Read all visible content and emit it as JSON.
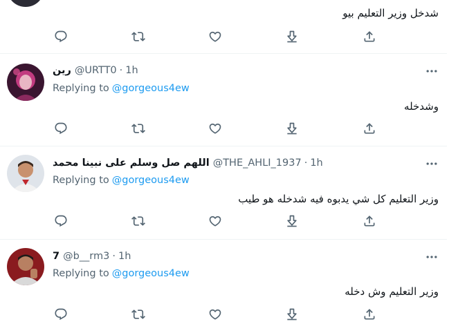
{
  "reply_prefix": "Replying to",
  "tweets": [
    {
      "display_name": "",
      "handle": "",
      "time": "",
      "mention": "",
      "text": "شدخل وزير التعليم بيو"
    },
    {
      "display_name": "رين",
      "handle": "@URTT0",
      "time": "1h",
      "mention": "@gorgeous4ew",
      "text": "وشدخله"
    },
    {
      "display_name": "اللهم صل وسلم على نبينا محمد",
      "handle": "@THE_AHLI_1937",
      "time": "1h",
      "mention": "@gorgeous4ew",
      "text": "وزير التعليم كل شي يدبوه فيه شدخله هو طيب"
    },
    {
      "display_name": "7",
      "handle": "@b__rm3",
      "time": "1h",
      "mention": "@gorgeous4ew",
      "text": "وزير التعليم وش دخله"
    }
  ],
  "colors": {
    "accent": "#1d9bf0",
    "muted": "#536471",
    "text": "#0f1419",
    "separator": "#eff3f4"
  },
  "icons": [
    "reply-icon",
    "retweet-icon",
    "like-icon",
    "download-icon",
    "share-icon",
    "more-icon"
  ]
}
